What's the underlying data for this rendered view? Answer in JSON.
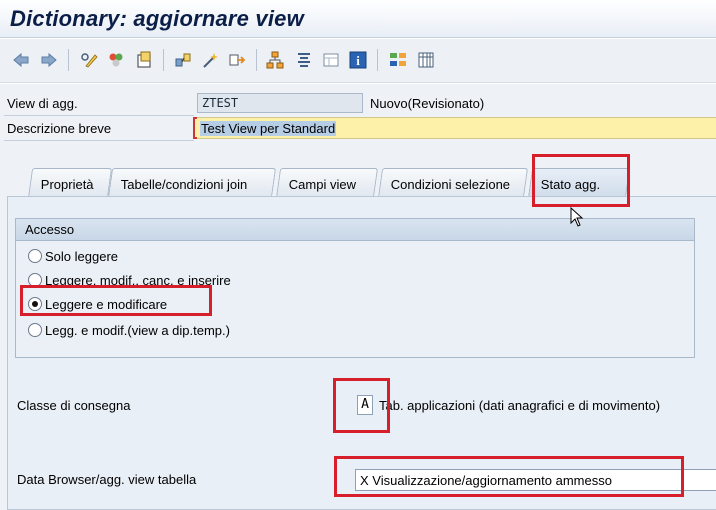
{
  "window": {
    "title": "Dictionary: aggiornare view"
  },
  "toolbar": {
    "icons": [
      "back-arrow-icon",
      "forward-arrow-icon",
      "display-change-icon",
      "other-object-icon",
      "activate-icon",
      "check-icon",
      "where-used-icon",
      "navigate-icon",
      "move-icon",
      "hierarchy-icon",
      "list-icon",
      "layout-icon",
      "info-icon",
      "structure-icon",
      "table-icon"
    ]
  },
  "header": {
    "view_label": "View di agg.",
    "view_value": "ZTEST",
    "view_status": "Nuovo(Revisionato)",
    "desc_label": "Descrizione breve",
    "desc_value": "Test View per Standard"
  },
  "tabs": [
    {
      "label": "Proprietà"
    },
    {
      "label": "Tabelle/condizioni join"
    },
    {
      "label": "Campi view"
    },
    {
      "label": "Condizioni selezione"
    },
    {
      "label": "Stato agg."
    }
  ],
  "access": {
    "title": "Accesso",
    "options": [
      {
        "label": "Solo leggere",
        "selected": false
      },
      {
        "label": "Leggere, modif., canc. e inserire",
        "selected": false
      },
      {
        "label": "Leggere e modificare",
        "selected": true
      },
      {
        "label": "Legg. e modif.(view a dip.temp.)",
        "selected": false
      }
    ]
  },
  "delivery": {
    "label": "Classe di consegna",
    "code": "A",
    "description": "Tab. applicazioni (dati anagrafici e di movimento)"
  },
  "browser": {
    "label": "Data Browser/agg. view tabella",
    "value": "X Visualizzazione/aggiornamento ammesso"
  },
  "colors": {
    "highlight": "#d61f2a",
    "required_field": "#fdf1a9",
    "title": "#0a1e48"
  }
}
